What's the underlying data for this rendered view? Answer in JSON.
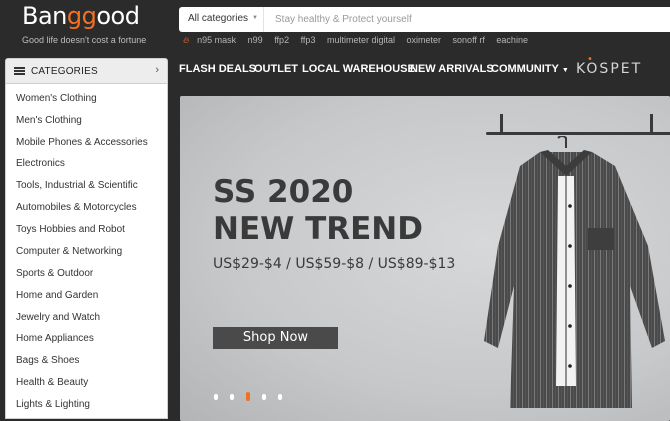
{
  "logo": {
    "text_prefix": "Ban",
    "text_accent": "gg",
    "text_suffix": "ood",
    "slogan": "Good life doesn't cost a fortune"
  },
  "search": {
    "category": "All categories",
    "placeholder": "Stay healthy & Protect yourself"
  },
  "hot_keywords": [
    "n95 mask",
    "n99",
    "ffp2",
    "ffp3",
    "multimeter digital",
    "oximeter",
    "sonoff rf",
    "eachine"
  ],
  "categories_header": "CATEGORIES",
  "nav": {
    "flash_deals": "FLASH DEALS",
    "outlet": "OUTLET",
    "local_warehouse": "LOCAL WAREHOUSE",
    "new_arrivals": "NEW ARRIVALS",
    "community": "COMMUNITY",
    "brand": "KOSPET"
  },
  "categories": [
    "Women's Clothing",
    "Men's Clothing",
    "Mobile Phones & Accessories",
    "Electronics",
    "Tools, Industrial & Scientific",
    "Automobiles & Motorcycles",
    "Toys Hobbies and Robot",
    "Computer & Networking",
    "Sports & Outdoor",
    "Home and Garden",
    "Jewelry and Watch",
    "Home Appliances",
    "Bags & Shoes",
    "Health & Beauty",
    "Lights & Lighting"
  ],
  "banner": {
    "line1": "SS 2020",
    "line2": "NEW TREND",
    "prices": "US$29-$4 / US$59-$8 / US$89-$13",
    "cta": "Shop Now",
    "slide_count": 5,
    "active_slide": 3
  },
  "colors": {
    "accent": "#f37021",
    "topbar": "#2b2b2b",
    "banner_bg": "#c7c9cb"
  }
}
